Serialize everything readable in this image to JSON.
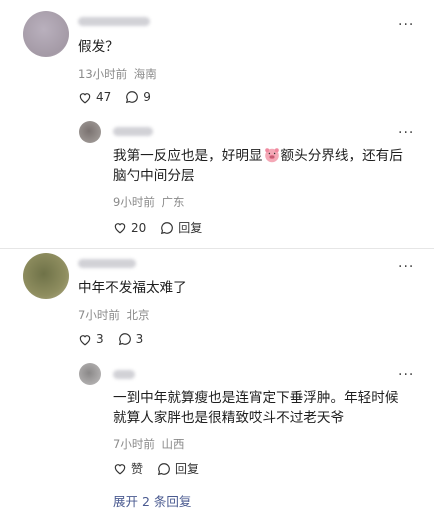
{
  "comments": [
    {
      "text": "假发？",
      "time": "13小时前",
      "location": "海南",
      "likes": "47",
      "replies": "9",
      "reply": {
        "text_before": "我第一反应也是，好明显",
        "text_after": "额头分界线，还有后",
        "text_line2": "脑勺中间分层",
        "time": "9小时前",
        "location": "广东",
        "likes": "20",
        "reply_label": "回复"
      }
    },
    {
      "text": "中年不发福太难了",
      "time": "7小时前",
      "location": "北京",
      "likes": "3",
      "replies": "3",
      "reply": {
        "text_line1": "一到中年就算瘦也是连宵定下垂浮肿。年轻时候",
        "text_line2": "就算人家胖也是很精致哎斗不过老天爷",
        "time": "7小时前",
        "location": "山西",
        "like_label": "赞",
        "reply_label": "回复"
      },
      "expand_label": "展开 2 条回复"
    }
  ],
  "icons": {
    "more": "more-dots-icon",
    "heart": "heart-icon",
    "comment": "comment-bubble-icon",
    "emoji": "pig-face-emoji-icon"
  }
}
